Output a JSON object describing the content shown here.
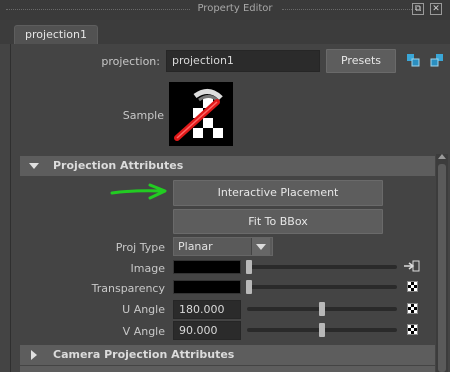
{
  "window": {
    "title": "Property Editor"
  },
  "tab": {
    "label": "projection1"
  },
  "header": {
    "projection_label": "projection:",
    "projection_value": "projection1",
    "presets_label": "Presets"
  },
  "sample": {
    "label": "Sample"
  },
  "sections": {
    "projection_attributes": "Projection Attributes",
    "camera_projection_attributes": "Camera Projection Attributes"
  },
  "buttons": {
    "interactive_placement": "Interactive Placement",
    "fit_to_bbox": "Fit To BBox"
  },
  "attributes": {
    "proj_type_label": "Proj Type",
    "proj_type_value": "Planar",
    "image_label": "Image",
    "transparency_label": "Transparency",
    "u_angle_label": "U Angle",
    "u_angle_value": "180.000",
    "v_angle_label": "V Angle",
    "v_angle_value": "90.000"
  },
  "sliders": {
    "image_level": 0,
    "transparency_level": 0,
    "u_angle_fraction": 0.5,
    "v_angle_fraction": 0.5
  },
  "colors": {
    "accent_arrow": "#22cc22",
    "image_swatch": "#000000",
    "transparency_swatch": "#000000"
  },
  "icons": {
    "sample": "projection-checker-icon",
    "link_in": "input-connection-icon",
    "map": "checker-map-icon"
  }
}
